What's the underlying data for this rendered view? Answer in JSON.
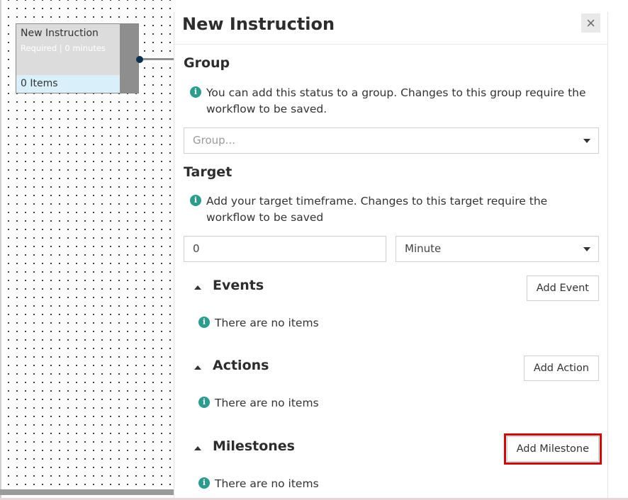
{
  "canvas": {
    "node": {
      "title": "New Instruction",
      "subtitle": "Required | 0 minutes",
      "items": "0 Items"
    }
  },
  "panel": {
    "title": "New Instruction",
    "close_icon": "×",
    "group": {
      "heading": "Group",
      "info_icon": "i",
      "info": "You can add this status to a group. Changes to this group require the workflow to be saved.",
      "select_placeholder": "Group..."
    },
    "target": {
      "heading": "Target",
      "info_icon": "i",
      "info": "Add your target timeframe. Changes to this target require the workflow to be saved",
      "value": "0",
      "unit": "Minute"
    },
    "events": {
      "heading": "Events",
      "button": "Add Event",
      "info_icon": "i",
      "empty": "There are no items"
    },
    "actions": {
      "heading": "Actions",
      "button": "Add Action",
      "info_icon": "i",
      "empty": "There are no items"
    },
    "milestones": {
      "heading": "Milestones",
      "button": "Add Milestone",
      "info_icon": "i",
      "empty": "There are no items"
    }
  },
  "colors": {
    "accent": "#2a9d8f",
    "node_dot": "#0c3150",
    "highlight": "#e00000"
  }
}
